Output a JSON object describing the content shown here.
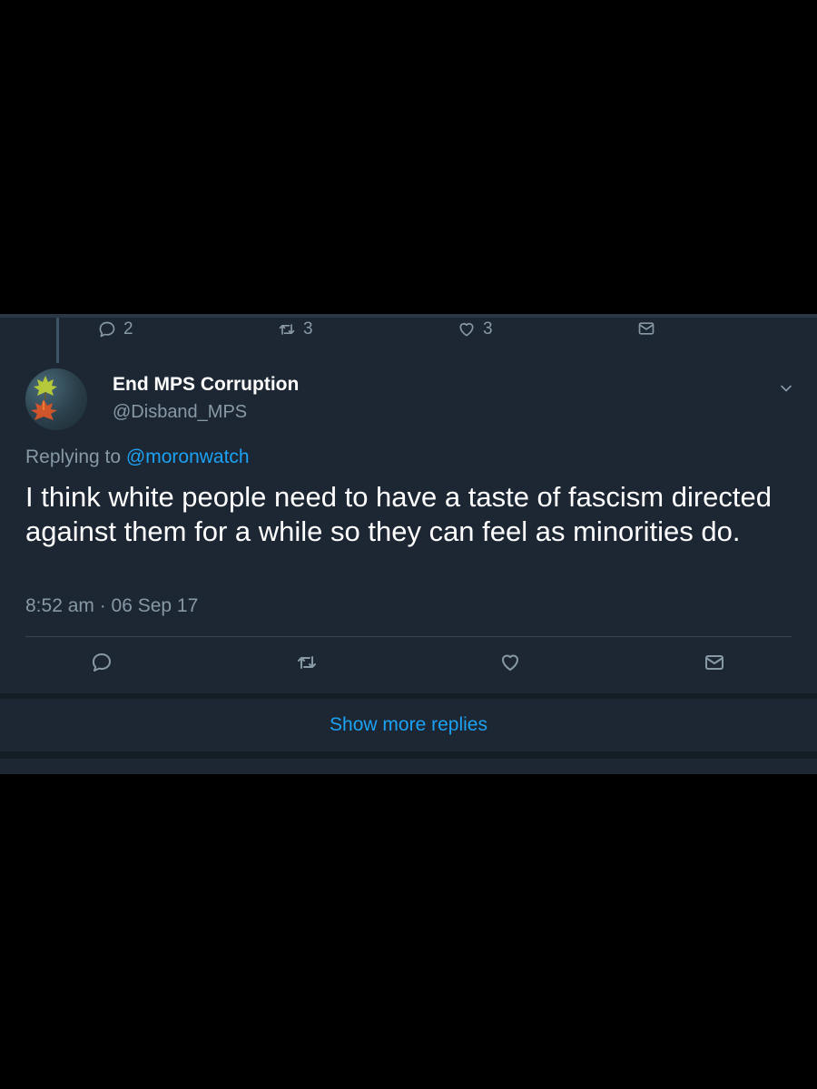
{
  "previous_tweet_actions": {
    "reply_count": "2",
    "retweet_count": "3",
    "like_count": "3"
  },
  "tweet": {
    "display_name": "End MPS Corruption",
    "handle": "@Disband_MPS",
    "replying_prefix": "Replying to ",
    "replying_to": "@moronwatch",
    "text": "I think white people need to have a taste of fascism directed against them for a while so they can feel as minorities do.",
    "timestamp": "8:52 am · 06 Sep 17"
  },
  "icons": {
    "reply": "reply-icon",
    "retweet": "retweet-icon",
    "like": "heart-icon",
    "message": "envelope-icon",
    "caret": "chevron-down-icon"
  },
  "show_more_label": "Show more replies",
  "colors": {
    "background": "#000000",
    "panel": "#1c2733",
    "primary_text": "#ffffff",
    "secondary_text": "#8899a6",
    "accent": "#1da1f2"
  }
}
